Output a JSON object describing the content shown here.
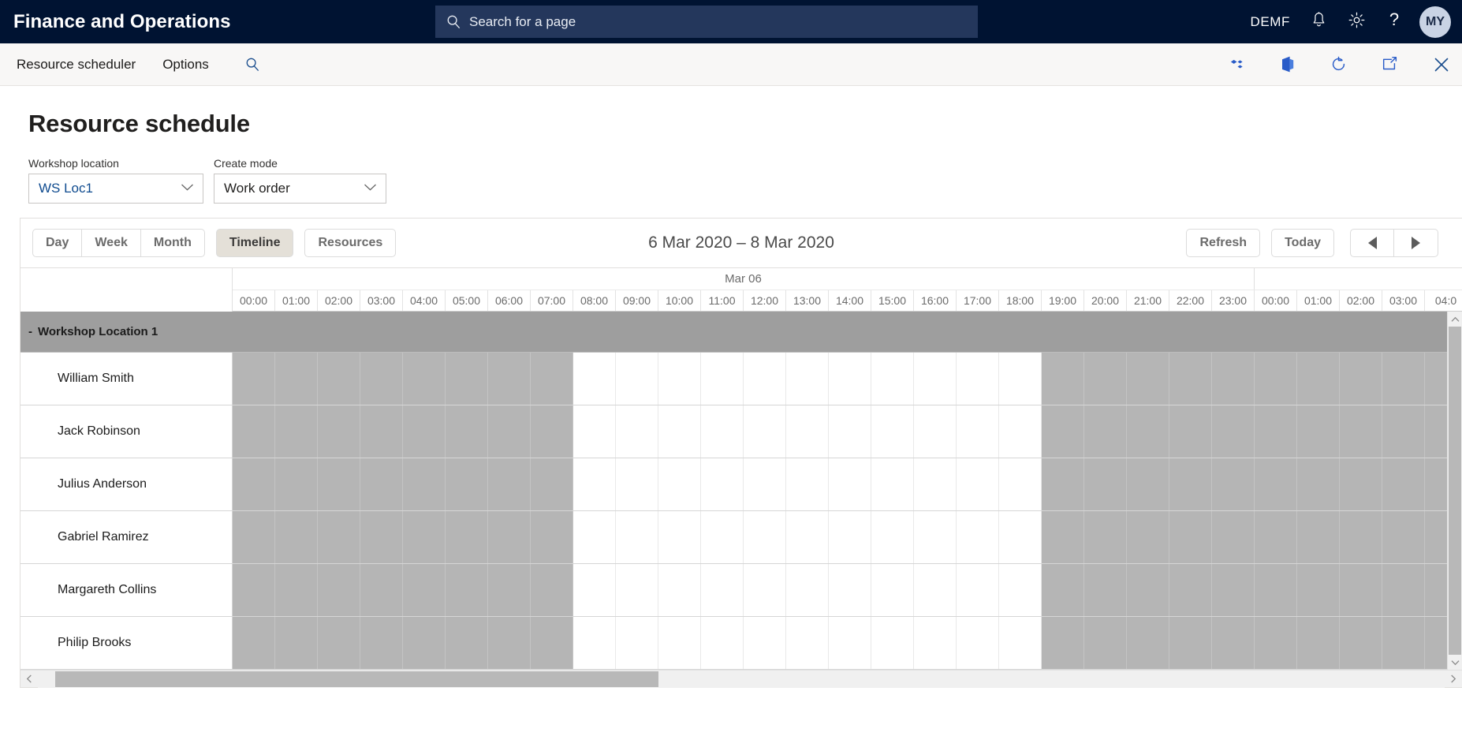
{
  "topbar": {
    "brand": "Finance and Operations",
    "search": {
      "icon": "search-icon",
      "placeholder": "Search for a page"
    },
    "company": "DEMF",
    "notifications_icon": "bell-icon",
    "settings_icon": "gear-icon",
    "help_icon": "question-mark-icon",
    "avatar_initials": "MY"
  },
  "commandbar": {
    "items": [
      "Resource scheduler",
      "Options"
    ],
    "search_icon": "search-icon",
    "right_icons": [
      "dynamics-icon",
      "office-apps-icon",
      "refresh-icon",
      "open-in-new-window-icon",
      "close-icon"
    ]
  },
  "page": {
    "title": "Resource schedule",
    "filters": [
      {
        "label": "Workshop location",
        "value": "WS Loc1",
        "icon": "chevron-down-icon"
      },
      {
        "label": "Create mode",
        "value": "Work order",
        "icon": "chevron-down-icon"
      }
    ]
  },
  "scheduler": {
    "view_buttons": [
      "Day",
      "Week",
      "Month"
    ],
    "mode_buttons": [
      {
        "label": "Timeline",
        "active": true
      },
      {
        "label": "Resources",
        "active": false
      }
    ],
    "date_range": "6 Mar 2020 – 8 Mar 2020",
    "refresh_label": "Refresh",
    "today_label": "Today",
    "prev_icon": "triangle-left-icon",
    "next_icon": "triangle-right-icon",
    "day_header": "Mar 06",
    "hours": [
      "00:00",
      "01:00",
      "02:00",
      "03:00",
      "04:00",
      "05:00",
      "06:00",
      "07:00",
      "08:00",
      "09:00",
      "10:00",
      "11:00",
      "12:00",
      "13:00",
      "14:00",
      "15:00",
      "16:00",
      "17:00",
      "18:00",
      "19:00",
      "20:00",
      "21:00",
      "22:00",
      "23:00",
      "00:00",
      "01:00",
      "02:00",
      "03:00",
      "04:0"
    ],
    "working_hours": {
      "start_index": 8,
      "end_index": 18
    },
    "group": {
      "toggle": "-",
      "label": "Workshop Location 1"
    },
    "resources": [
      {
        "name": "William Smith"
      },
      {
        "name": "Jack Robinson"
      },
      {
        "name": "Julius Anderson"
      },
      {
        "name": "Gabriel Ramirez"
      },
      {
        "name": "Margareth Collins"
      },
      {
        "name": "Philip Brooks"
      }
    ],
    "scroll": {
      "h_left_icon": "chevron-left-icon",
      "h_right_icon": "chevron-right-icon",
      "v_up_icon": "chevron-up-icon",
      "v_down_icon": "chevron-down-icon"
    }
  },
  "colors": {
    "topbar_bg": "#001332",
    "search_bg": "#24375c",
    "accent": "#0f4b8f",
    "group_row": "#9e9e9e",
    "off_hours": "#b5b5b5",
    "active_button": "#e4e0d8"
  }
}
